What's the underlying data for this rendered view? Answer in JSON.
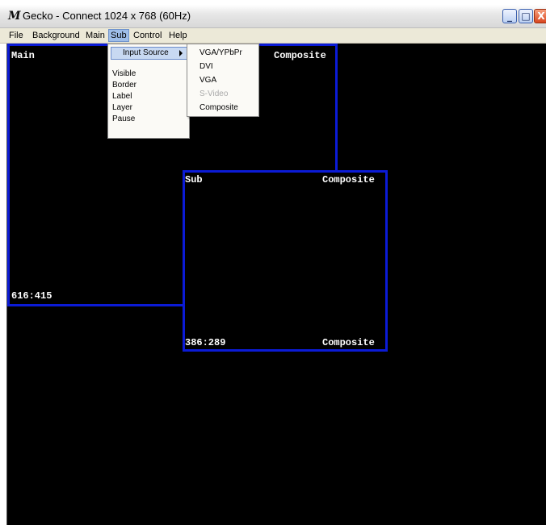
{
  "window": {
    "title": "Gecko - Connect 1024 x 768 (60Hz)",
    "icon": "M",
    "controls": {
      "minimize": "_",
      "maximize": "□",
      "close": "X"
    }
  },
  "menubar": {
    "items": [
      "File",
      "Background",
      "Main",
      "Sub",
      "Control",
      "Help"
    ],
    "active": "Sub"
  },
  "sub_menu": {
    "items": [
      {
        "label": "Input Source",
        "has_submenu": true,
        "highlighted": true
      },
      {
        "label": "Visible"
      },
      {
        "label": "Border"
      },
      {
        "label": "Label"
      },
      {
        "label": "Layer"
      },
      {
        "label": "Pause"
      }
    ]
  },
  "input_source_menu": {
    "items": [
      {
        "label": "VGA/YPbPr",
        "enabled": true
      },
      {
        "label": "DVI",
        "enabled": true
      },
      {
        "label": "VGA",
        "enabled": true
      },
      {
        "label": "S-Video",
        "enabled": false
      },
      {
        "label": "Composite",
        "enabled": true
      }
    ]
  },
  "main_window": {
    "name": "Main",
    "source": "Composite",
    "resolution": "616:415"
  },
  "sub_window": {
    "name": "Sub",
    "source_top": "Composite",
    "resolution": "386:289",
    "source_bottom": "Composite"
  },
  "colors": {
    "frame_border": "#0b1bd6",
    "viewport_bg": "#000000",
    "menu_highlight": "#c8d9f2"
  }
}
